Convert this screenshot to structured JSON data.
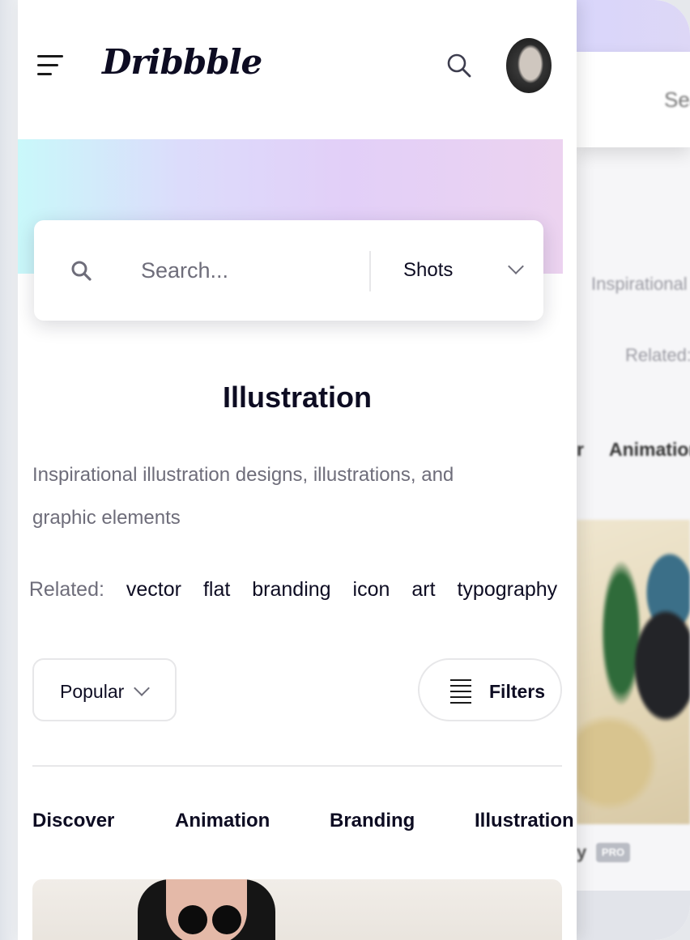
{
  "app": {
    "logo_text": "Dribbble",
    "brand_color": "#0d0c22",
    "accent_gradient": [
      "#c9f8fa",
      "#e2cff8",
      "#ecd3f0"
    ]
  },
  "header": {
    "menu_icon": "hamburger-icon",
    "search_icon": "search-icon",
    "avatar": "user-avatar"
  },
  "search": {
    "placeholder": "Search...",
    "value": "",
    "type_selected": "Shots"
  },
  "page": {
    "title": "Illustration",
    "description": "Inspirational illustration designs, illustrations, and graphic elements"
  },
  "related": {
    "label": "Related:",
    "tags": [
      "vector",
      "flat",
      "branding",
      "icon",
      "art",
      "typography"
    ]
  },
  "controls": {
    "sort_label": "Popular",
    "filters_label": "Filters"
  },
  "categories": [
    "Discover",
    "Animation",
    "Branding",
    "Illustration"
  ],
  "background_screen": {
    "search_text": "Sea",
    "desc_text": "Inspirational i",
    "related_text": "Related:",
    "cat_partial": "r",
    "cat_text": "Animation",
    "shot_partial": "y",
    "badge": "PRO"
  }
}
